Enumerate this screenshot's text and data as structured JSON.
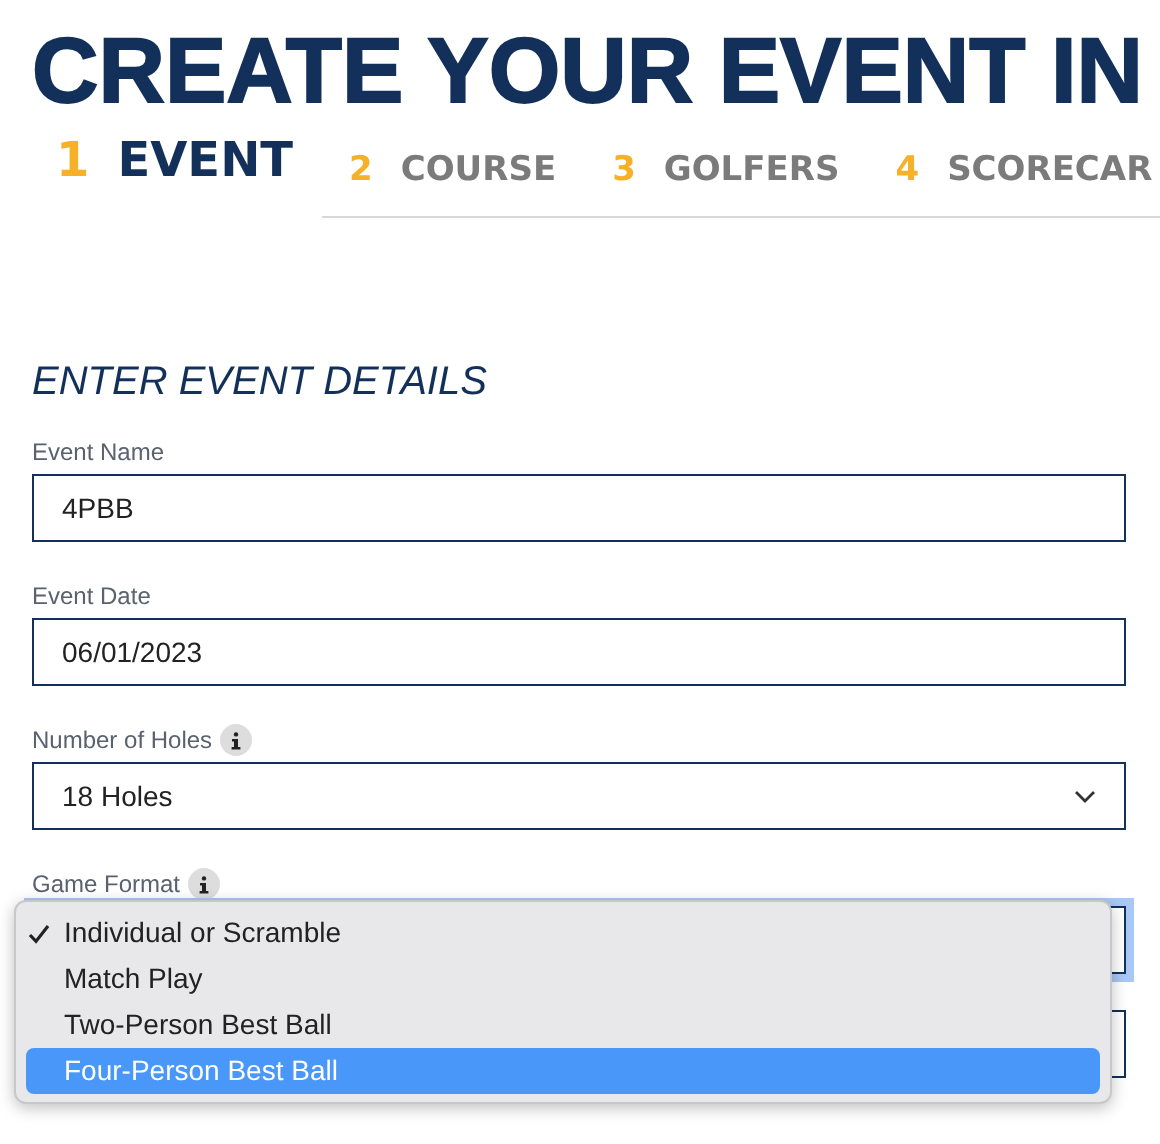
{
  "heading": "CREATE YOUR EVENT IN",
  "steps": [
    {
      "number": "1",
      "label": "EVENT",
      "selected": true
    },
    {
      "number": "2",
      "label": "COURSE",
      "selected": false
    },
    {
      "number": "3",
      "label": "GOLFERS",
      "selected": false
    },
    {
      "number": "4",
      "label": "SCORECAR",
      "selected": false
    }
  ],
  "section_title": "ENTER EVENT DETAILS",
  "fields": [
    {
      "kind": "text",
      "label": "Event Name",
      "value": "4PBB",
      "info": false
    },
    {
      "kind": "text",
      "label": "Event Date",
      "value": "06/01/2023",
      "info": false
    },
    {
      "kind": "select",
      "label": "Number of Holes",
      "value": "18 Holes",
      "info": true
    },
    {
      "kind": "select-open",
      "label": "Game Format",
      "info": true
    }
  ],
  "game_format_options": [
    {
      "label": "Individual or Scramble",
      "checked": true,
      "selected": false
    },
    {
      "label": "Match Play",
      "checked": false,
      "selected": false
    },
    {
      "label": "Two-Person Best Ball",
      "checked": false,
      "selected": false
    },
    {
      "label": "Four-Person Best Ball",
      "checked": false,
      "selected": true
    }
  ]
}
